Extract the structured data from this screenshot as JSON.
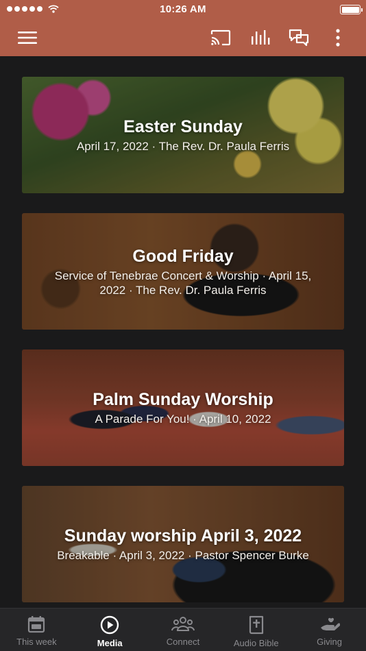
{
  "status_bar": {
    "time": "10:26 AM"
  },
  "toolbar": {
    "menu_icon": "hamburger-menu-icon",
    "cast_icon": "cast-icon",
    "audio_icon": "audio-bars-icon",
    "chat_icon": "chat-bubbles-icon",
    "more_icon": "more-vertical-icon"
  },
  "media_items": [
    {
      "title": "Easter Sunday",
      "subtitle": "April 17, 2022 · The Rev. Dr. Paula Ferris"
    },
    {
      "title": "Good Friday",
      "subtitle": "Service of Tenebrae Concert & Worship · April 15, 2022 · The Rev. Dr. Paula Ferris"
    },
    {
      "title": "Palm Sunday Worship",
      "subtitle": "A Parade For You! · April 10, 2022"
    },
    {
      "title": "Sunday worship April 3, 2022",
      "subtitle": "Breakable · April 3, 2022 · Pastor Spencer Burke"
    }
  ],
  "tabs": [
    {
      "label": "This week",
      "icon": "calendar-icon",
      "active": false
    },
    {
      "label": "Media",
      "icon": "play-circle-icon",
      "active": true
    },
    {
      "label": "Connect",
      "icon": "people-group-icon",
      "active": false
    },
    {
      "label": "Audio Bible",
      "icon": "bible-icon",
      "active": false
    },
    {
      "label": "Giving",
      "icon": "giving-hand-icon",
      "active": false
    }
  ],
  "colors": {
    "header": "#b05d48",
    "background": "#1a1a1b",
    "tabbar": "#262628",
    "tab_active": "#ffffff",
    "tab_inactive": "#8a8a8e"
  }
}
